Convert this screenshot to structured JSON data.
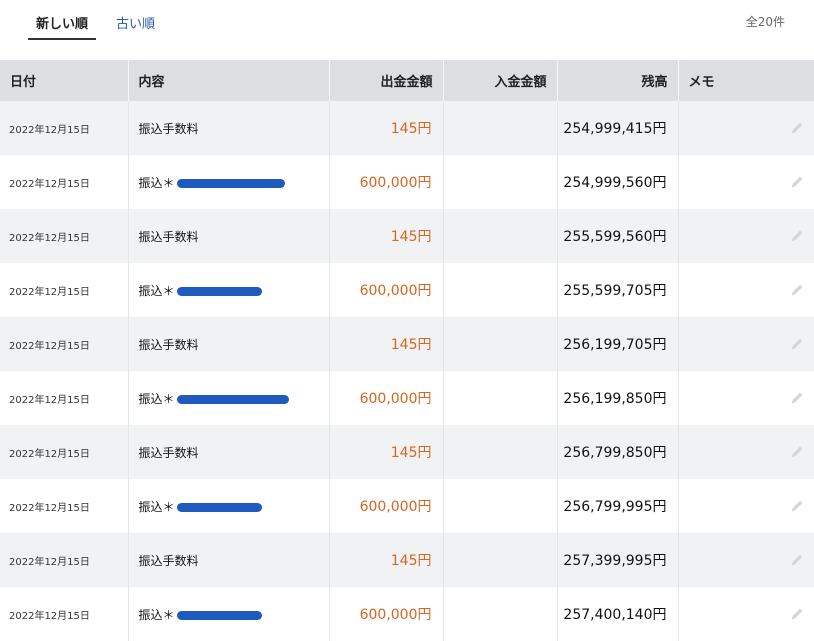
{
  "tabs": {
    "newest": "新しい順",
    "oldest": "古い順",
    "total_count": "全20件"
  },
  "table": {
    "headers": {
      "date": "日付",
      "description": "内容",
      "withdrawal": "出金金額",
      "deposit": "入金金額",
      "balance": "残高",
      "memo": "メモ"
    },
    "rows": [
      {
        "date": "2022年12月15日",
        "description": "振込手数料",
        "redacted": false,
        "withdrawal": "145円",
        "deposit": "",
        "balance": "254,999,415円"
      },
      {
        "date": "2022年12月15日",
        "description": "振込＊",
        "redacted": true,
        "withdrawal": "600,000円",
        "deposit": "",
        "balance": "254,999,560円"
      },
      {
        "date": "2022年12月15日",
        "description": "振込手数料",
        "redacted": false,
        "withdrawal": "145円",
        "deposit": "",
        "balance": "255,599,560円"
      },
      {
        "date": "2022年12月15日",
        "description": "振込＊",
        "redacted": true,
        "withdrawal": "600,000円",
        "deposit": "",
        "balance": "255,599,705円"
      },
      {
        "date": "2022年12月15日",
        "description": "振込手数料",
        "redacted": false,
        "withdrawal": "145円",
        "deposit": "",
        "balance": "256,199,705円"
      },
      {
        "date": "2022年12月15日",
        "description": "振込＊",
        "redacted": true,
        "withdrawal": "600,000円",
        "deposit": "",
        "balance": "256,199,850円"
      },
      {
        "date": "2022年12月15日",
        "description": "振込手数料",
        "redacted": false,
        "withdrawal": "145円",
        "deposit": "",
        "balance": "256,799,850円"
      },
      {
        "date": "2022年12月15日",
        "description": "振込＊",
        "redacted": true,
        "withdrawal": "600,000円",
        "deposit": "",
        "balance": "256,799,995円"
      },
      {
        "date": "2022年12月15日",
        "description": "振込手数料",
        "redacted": false,
        "withdrawal": "145円",
        "deposit": "",
        "balance": "257,399,995円"
      },
      {
        "date": "2022年12月15日",
        "description": "振込＊",
        "redacted": true,
        "withdrawal": "600,000円",
        "deposit": "",
        "balance": "257,400,140円"
      }
    ]
  },
  "colors": {
    "withdrawal_text": "#d9651f",
    "header_bg": "#dcdee2",
    "row_alt_bg": "#f1f2f4",
    "tab_link": "#2a5caa",
    "redaction": "#1f5bbf"
  },
  "icons": {
    "memo_edit": "pencil-icon"
  }
}
